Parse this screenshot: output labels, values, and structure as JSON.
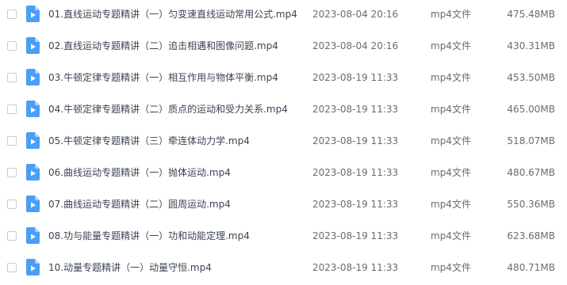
{
  "files": [
    {
      "name": "01.直线运动专题精讲（一）匀变速直线运动常用公式.mp4",
      "modified": "2023-08-04 20:16",
      "type": "mp4文件",
      "size": "475.48MB"
    },
    {
      "name": "02.直线运动专题精讲（二）追击相遇和图像问题.mp4",
      "modified": "2023-08-04 20:16",
      "type": "mp4文件",
      "size": "430.31MB"
    },
    {
      "name": "03.牛顿定律专题精讲（一）相互作用与物体平衡.mp4",
      "modified": "2023-08-19 11:33",
      "type": "mp4文件",
      "size": "453.50MB"
    },
    {
      "name": "04.牛顿定律专题精讲（二）质点的运动和受力关系.mp4",
      "modified": "2023-08-19 11:33",
      "type": "mp4文件",
      "size": "465.00MB"
    },
    {
      "name": "05.牛顿定律专题精讲（三）牵连体动力学.mp4",
      "modified": "2023-08-19 11:33",
      "type": "mp4文件",
      "size": "518.07MB"
    },
    {
      "name": "06.曲线运动专题精讲（一）抛体运动.mp4",
      "modified": "2023-08-19 11:33",
      "type": "mp4文件",
      "size": "480.67MB"
    },
    {
      "name": "07.曲线运动专题精讲（二）圆周运动.mp4",
      "modified": "2023-08-19 11:33",
      "type": "mp4文件",
      "size": "550.36MB"
    },
    {
      "name": "08.功与能量专题精讲（一）功和动能定理.mp4",
      "modified": "2023-08-19 11:33",
      "type": "mp4文件",
      "size": "623.68MB"
    },
    {
      "name": "10.动量专题精讲（一）动量守恒.mp4",
      "modified": "2023-08-19 11:33",
      "type": "mp4文件",
      "size": "480.71MB"
    }
  ],
  "icons": {
    "file_icon": "video-file-icon",
    "file_icon_color": "#4a9ef5",
    "checkbox": "checkbox"
  }
}
